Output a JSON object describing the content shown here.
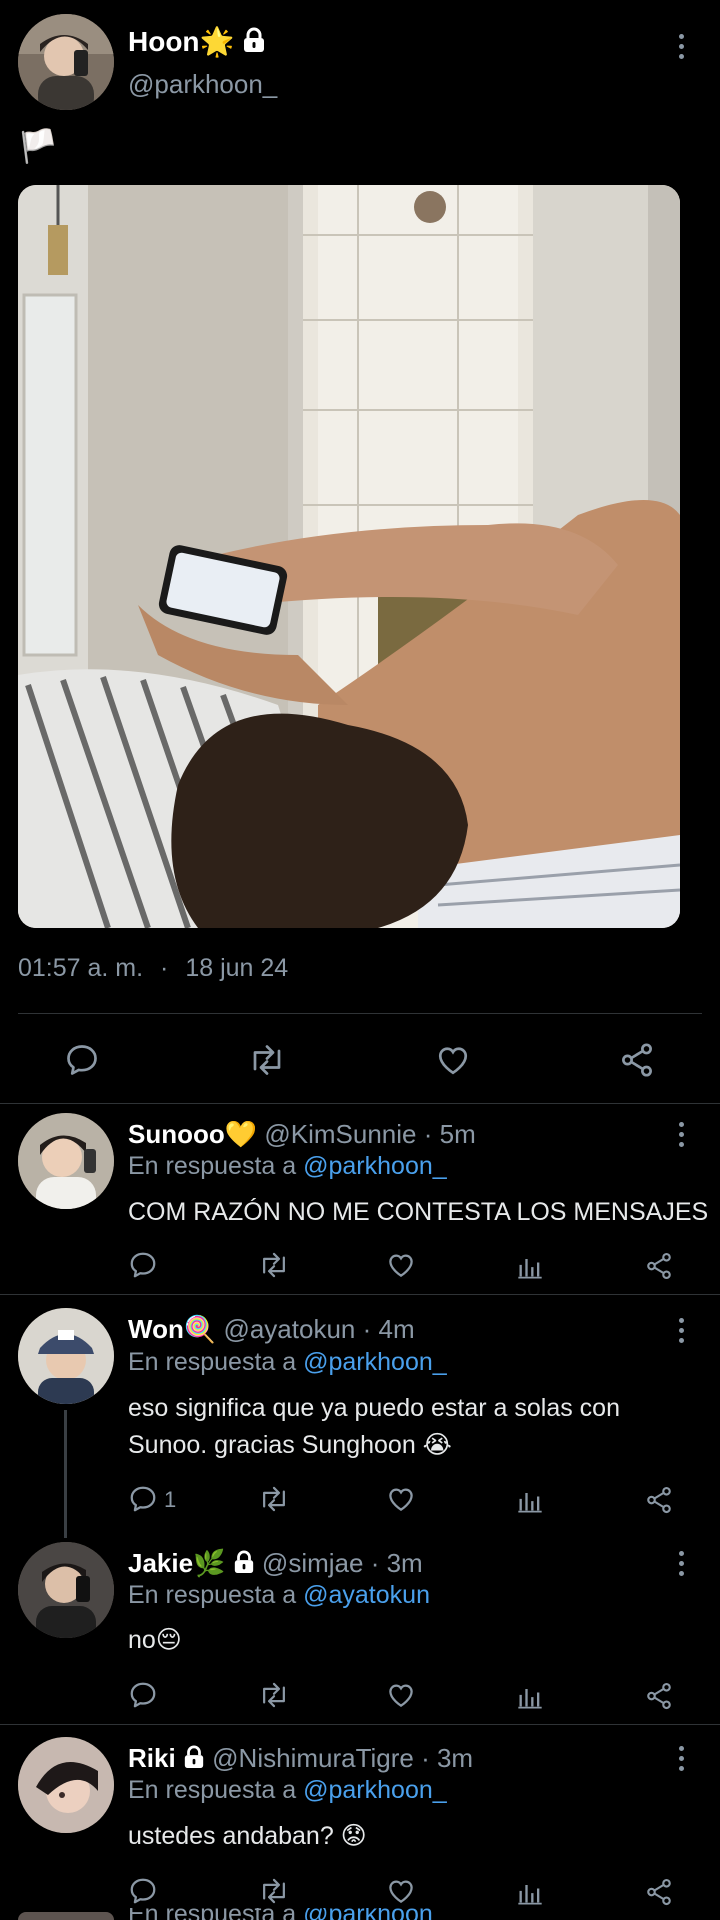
{
  "main_tweet": {
    "display_name": "Hoon",
    "name_emoji": "🌟",
    "handle": "@parkhoon_",
    "text": "🏳️",
    "time": "01:57 a. m.",
    "dot": "·",
    "date": "18 jun 24"
  },
  "icons": {
    "reply": "reply-icon",
    "retweet": "retweet-icon",
    "like": "heart-icon",
    "share": "share-icon",
    "views": "views-icon",
    "more": "more-icon",
    "lock": "lock-icon"
  },
  "colors": {
    "background": "#000000",
    "muted": "#8b98a5",
    "link": "#4aa0ec",
    "divider": "#2f3336"
  },
  "replies": [
    {
      "display_name": "Sunooo",
      "name_emoji": "💛",
      "handle": "@KimSunnie",
      "time": "· 5m",
      "in_reply_prefix": "En respuesta a",
      "in_reply_to": "@parkhoon_",
      "text_lines": [
        "COM RAZÓN NO ME CONTESTA LOS MENSAJES"
      ],
      "reply_count": ""
    },
    {
      "display_name": "Won",
      "name_emoji": "🍭",
      "handle": "@ayatokun",
      "time": "· 4m",
      "in_reply_prefix": "En respuesta a",
      "in_reply_to": "@parkhoon_",
      "text_lines": [
        "eso significa que ya puedo estar a solas con",
        "Sunoo. gracias Sunghoon 😭"
      ],
      "reply_count": "1"
    },
    {
      "display_name": "Jakie",
      "name_emoji": "🌿",
      "handle": "@simjae",
      "time": "· 3m",
      "in_reply_prefix": "En respuesta a",
      "in_reply_to": "@ayatokun",
      "text_lines": [
        "no😔"
      ],
      "reply_count": ""
    },
    {
      "display_name": "Riki",
      "name_emoji": "",
      "handle": "@NishimuraTigre",
      "time": "· 3m",
      "in_reply_prefix": "En respuesta a",
      "in_reply_to": "@parkhoon_",
      "text_lines": [
        "ustedes andaban? 😟"
      ],
      "reply_count": ""
    }
  ],
  "partial_next": {
    "in_reply_prefix": "En respuesta a",
    "in_reply_to": "@parkhoon_"
  }
}
